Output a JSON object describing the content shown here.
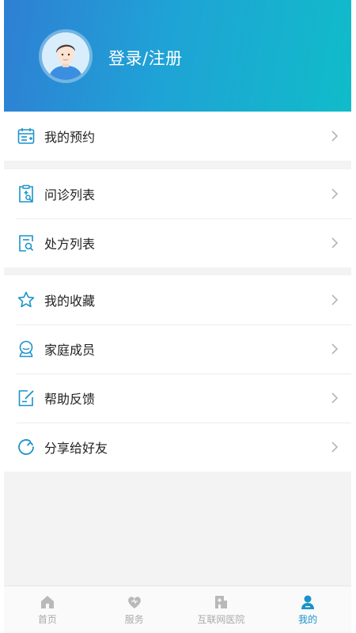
{
  "header": {
    "login_label": "登录/注册"
  },
  "menu": {
    "group1": [
      {
        "label": "我的预约",
        "icon": "calendar-icon"
      }
    ],
    "group2": [
      {
        "label": "问诊列表",
        "icon": "consultation-list-icon"
      },
      {
        "label": "处方列表",
        "icon": "prescription-list-icon"
      }
    ],
    "group3": [
      {
        "label": "我的收藏",
        "icon": "star-icon"
      },
      {
        "label": "家庭成员",
        "icon": "family-members-icon"
      },
      {
        "label": "帮助反馈",
        "icon": "feedback-edit-icon"
      },
      {
        "label": "分享给好友",
        "icon": "share-refresh-icon"
      }
    ]
  },
  "tabbar": {
    "tabs": [
      {
        "label": "首页",
        "icon": "home-icon",
        "active": false
      },
      {
        "label": "服务",
        "icon": "heart-service-icon",
        "active": false
      },
      {
        "label": "互联网医院",
        "icon": "hospital-icon",
        "active": false
      },
      {
        "label": "我的",
        "icon": "user-icon",
        "active": true
      }
    ]
  },
  "colors": {
    "accent": "#1a93c9",
    "header_gradient_start": "#2f7fd4",
    "header_gradient_end": "#10bcc9",
    "inactive_tab": "#aaaaaa"
  }
}
